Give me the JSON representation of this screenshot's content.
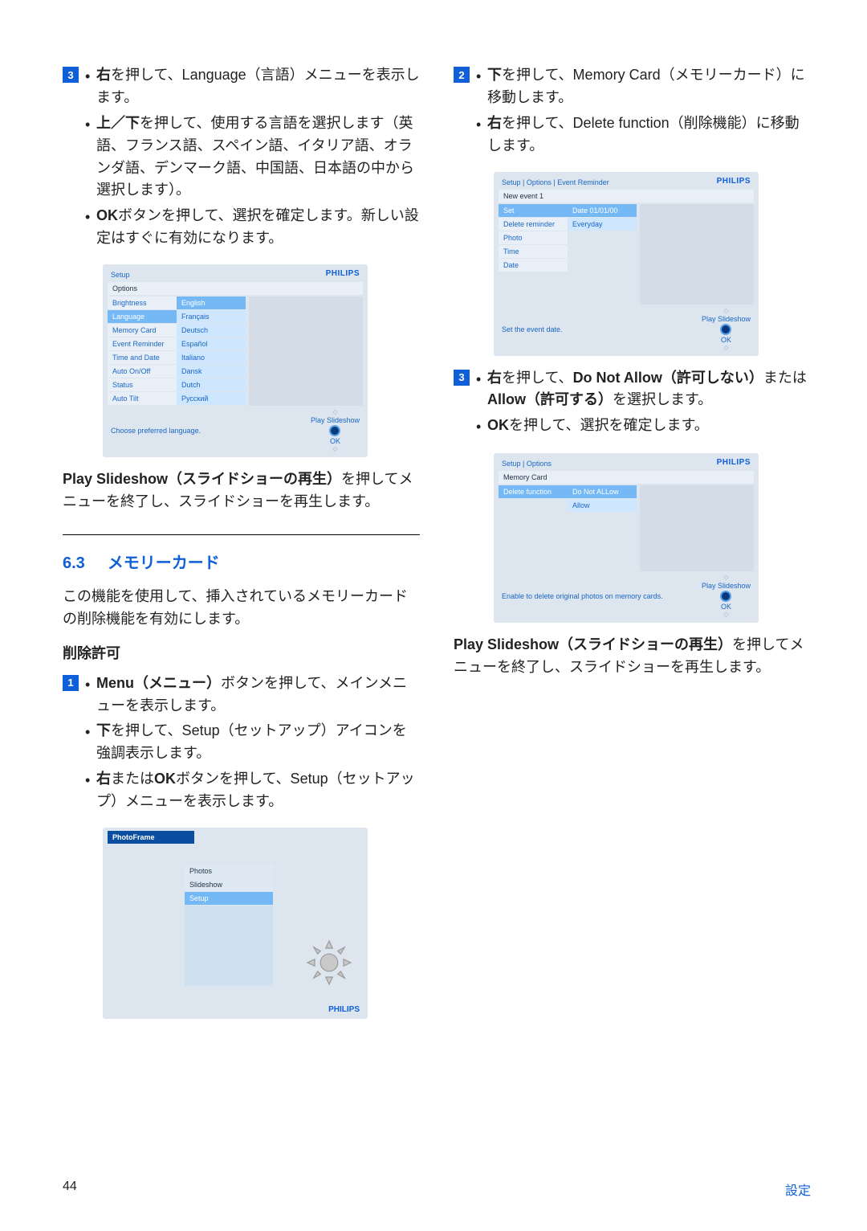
{
  "page_number": "44",
  "footer_section": "設定",
  "left": {
    "step3": {
      "b1_pre": "右",
      "b1_mid": "を押して、Language（言語）メニューを表示します。",
      "b2": "上／下を押して、使用する言語を選択します（英語、フランス語、スペイン語、イタリア語、オランダ語、デンマーク語、中国語、日本語の中から選択します）。",
      "b3_pre": "OK",
      "b3_mid": "ボタンを押して、選択を確定します。新しい設定はすぐに有効になります。"
    },
    "shot1": {
      "crumb": "Setup",
      "group": "Options",
      "philips": "PHILIPS",
      "col1": [
        "Brightness",
        "Language",
        "Memory Card",
        "Event Reminder",
        "Time and Date",
        "Auto On/Off",
        "Status",
        "Auto  Tilt"
      ],
      "col2": [
        "English",
        "Français",
        "Deutsch",
        "Español",
        "Italiano",
        "Dansk",
        "Dutch",
        "Русский"
      ],
      "footer_left": "Choose  preferred  language.",
      "footer_right_top": "Play  Slideshow",
      "footer_right_bot": "OK"
    },
    "play_para": {
      "p1_a": "Play Slideshow（スライドショーの再生）",
      "p1_b": "を押してメニューを終了し、スライドショーを再生します。"
    },
    "sec": {
      "num": "6.3",
      "title": "メモリーカード"
    },
    "sec_intro": "この機能を使用して、挿入されているメモリーカードの削除機能を有効にします。",
    "sub": "削除許可",
    "step1": {
      "b1_a": "Menu（メニュー）",
      "b1_b": "ボタンを押して、メインメニューを表示します。",
      "b2_a": "下",
      "b2_b": "を押して、Setup（セットアップ）アイコンを強調表示します。",
      "b3_a": "右",
      "b3_b": "または",
      "b3_c": "OK",
      "b3_d": "ボタンを押して、Setup（セットアップ）メニューを表示します。"
    },
    "shot2": {
      "title": "PhotoFrame",
      "items": [
        "Photos",
        "Slideshow",
        "Setup"
      ],
      "philips": "PHILIPS"
    }
  },
  "right": {
    "step2": {
      "b1_a": "下",
      "b1_b": "を押して、Memory Card（メモリーカード）に移動します。",
      "b2_a": "右",
      "b2_b": "を押して、Delete function（削除機能）に移動します。"
    },
    "shot3": {
      "crumb": "Setup | Options | Event Reminder",
      "group": "New event 1",
      "philips": "PHILIPS",
      "col1": [
        "Set",
        "Delete reminder",
        "Photo",
        "Time",
        "Date"
      ],
      "col2": [
        "Date   01/01/00",
        "Everyday"
      ],
      "footer_left": "Set the event date.",
      "footer_right_top": "Play  Slideshow",
      "footer_right_bot": "OK"
    },
    "step3": {
      "b1_a": "右",
      "b1_b": "を押して、",
      "b1_c": "Do Not Allow（許可しない）",
      "b1_d": "または",
      "b1_e": "Allow（許可する）",
      "b1_f": "を選択します。",
      "b2_a": "OK",
      "b2_b": "を押して、選択を確定します。"
    },
    "shot4": {
      "crumb": "Setup | Options",
      "group": "Memory Card",
      "philips": "PHILIPS",
      "col1": [
        "Delete function"
      ],
      "col2": [
        "Do  Not  ALLow",
        "Allow"
      ],
      "footer_left": "Enable to delete original photos on memory cards.",
      "footer_right_top": "Play  Slideshow",
      "footer_right_bot": "OK"
    },
    "play_para": {
      "p1_a": "Play Slideshow（スライドショーの再生）",
      "p1_b": "を押してメニューを終了し、スライドショーを再生します。"
    }
  }
}
